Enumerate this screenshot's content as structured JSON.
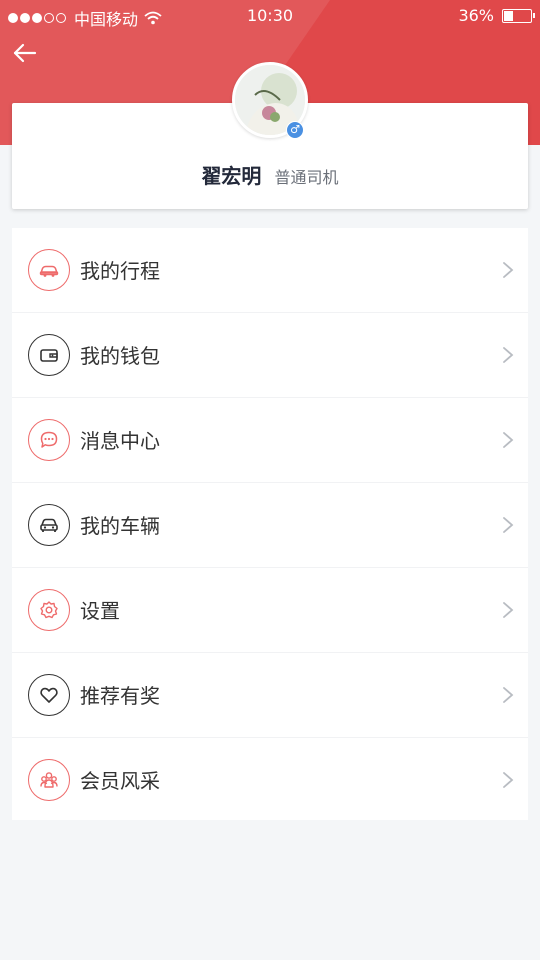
{
  "status_bar": {
    "carrier": "中国移动",
    "time": "10:30",
    "battery_percent": "36%",
    "battery_level": 0.36
  },
  "colors": {
    "primary": "#e0484a",
    "icon_red": "#ee6b6b",
    "icon_dark": "#333333",
    "gender_badge": "#4a90e2"
  },
  "header": {
    "back_icon": "arrow-left-icon"
  },
  "profile": {
    "name": "翟宏明",
    "role": "普通司机",
    "gender_icon": "male-icon",
    "gender_symbol": "♂"
  },
  "menu": {
    "items": [
      {
        "label": "我的行程",
        "icon": "car-icon",
        "tone": "red"
      },
      {
        "label": "我的钱包",
        "icon": "wallet-icon",
        "tone": "dark"
      },
      {
        "label": "消息中心",
        "icon": "message-icon",
        "tone": "red"
      },
      {
        "label": "我的车辆",
        "icon": "vehicle-icon",
        "tone": "dark"
      },
      {
        "label": "设置",
        "icon": "settings-icon",
        "tone": "red"
      },
      {
        "label": "推荐有奖",
        "icon": "heart-icon",
        "tone": "dark"
      },
      {
        "label": "会员风采",
        "icon": "members-icon",
        "tone": "red"
      }
    ]
  }
}
